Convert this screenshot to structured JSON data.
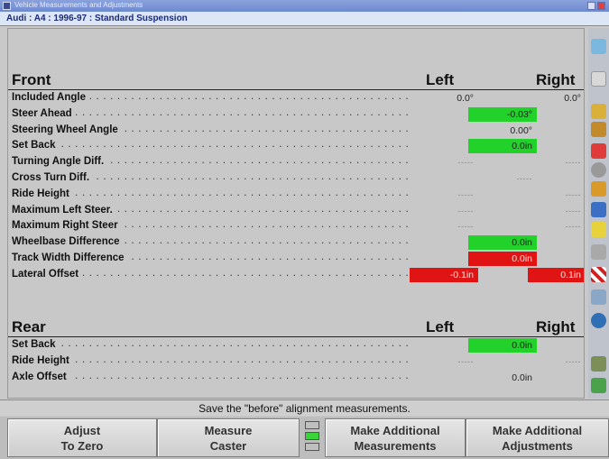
{
  "window": {
    "title": "Vehicle Measurements and Adjustments"
  },
  "vehicle": {
    "label": "Audi : A4 : 1996-97 : Standard Suspension"
  },
  "front": {
    "title": "Front",
    "left_header": "Left",
    "right_header": "Right",
    "rows": [
      {
        "label": "Included Angle",
        "cells": [
          {
            "pos": "left",
            "value": "0.0°",
            "status": "plain"
          },
          {
            "pos": "right",
            "value": "0.0°",
            "status": "plain"
          }
        ]
      },
      {
        "label": "Steer Ahead",
        "cells": [
          {
            "pos": "center",
            "value": "-0.03°",
            "status": "green"
          }
        ]
      },
      {
        "label": "Steering Wheel Angle",
        "cells": [
          {
            "pos": "center",
            "value": "0.00°",
            "status": "plain"
          }
        ]
      },
      {
        "label": "Set Back",
        "cells": [
          {
            "pos": "center",
            "value": "0.0in",
            "status": "green"
          }
        ]
      },
      {
        "label": "Turning Angle Diff.",
        "cells": [
          {
            "pos": "left",
            "value": "-----",
            "status": "blank"
          },
          {
            "pos": "right",
            "value": "-----",
            "status": "blank"
          }
        ]
      },
      {
        "label": "Cross Turn Diff.",
        "cells": [
          {
            "pos": "center",
            "value": "-----",
            "status": "blank"
          }
        ]
      },
      {
        "label": "Ride Height",
        "cells": [
          {
            "pos": "left",
            "value": "-----",
            "status": "blank"
          },
          {
            "pos": "right",
            "value": "-----",
            "status": "blank"
          }
        ]
      },
      {
        "label": "Maximum Left Steer.",
        "cells": [
          {
            "pos": "left",
            "value": "-----",
            "status": "blank"
          },
          {
            "pos": "right",
            "value": "-----",
            "status": "blank"
          }
        ]
      },
      {
        "label": "Maximum Right Steer",
        "cells": [
          {
            "pos": "left",
            "value": "-----",
            "status": "blank"
          },
          {
            "pos": "right",
            "value": "-----",
            "status": "blank"
          }
        ]
      },
      {
        "label": "Wheelbase Difference",
        "cells": [
          {
            "pos": "center",
            "value": "0.0in",
            "status": "green"
          }
        ]
      },
      {
        "label": "Track Width Difference",
        "cells": [
          {
            "pos": "center",
            "value": "0.0in",
            "status": "red"
          }
        ]
      },
      {
        "label": "Lateral Offset",
        "cells": [
          {
            "pos": "left",
            "value": "-0.1in",
            "status": "red"
          },
          {
            "pos": "right",
            "value": "0.1in",
            "status": "red"
          }
        ]
      }
    ]
  },
  "rear": {
    "title": "Rear",
    "left_header": "Left",
    "right_header": "Right",
    "rows": [
      {
        "label": "Set Back",
        "cells": [
          {
            "pos": "center",
            "value": "0.0in",
            "status": "green"
          }
        ]
      },
      {
        "label": "Ride Height",
        "cells": [
          {
            "pos": "left",
            "value": "-----",
            "status": "blank"
          },
          {
            "pos": "right",
            "value": "-----",
            "status": "blank"
          }
        ]
      },
      {
        "label": "Axle Offset",
        "cells": [
          {
            "pos": "center",
            "value": "0.0in",
            "status": "plain"
          }
        ]
      }
    ]
  },
  "status_message": "Save the \"before\" alignment measurements.",
  "buttons": {
    "adjust_zero": [
      "Adjust",
      "To Zero"
    ],
    "measure_caster": [
      "Measure",
      "Caster"
    ],
    "additional_measurements": [
      "Make Additional",
      "Measurements"
    ],
    "additional_adjustments": [
      "Make Additional",
      "Adjustments"
    ]
  },
  "toolbar_icons": [
    "help-icon",
    "specs-icon",
    "wrench-icon",
    "tools-icon",
    "gauge-icon",
    "wheel-icon",
    "vehicle-icon",
    "steering-icon",
    "ruler-icon",
    "printer-icon",
    "checkered-flag-icon",
    "camera-icon",
    "globe-icon",
    "pencil-icon",
    "brake-icon"
  ],
  "colors": {
    "in_spec": "#22d22a",
    "out_of_spec": "#e11414",
    "header_text": "#1a2a78"
  }
}
